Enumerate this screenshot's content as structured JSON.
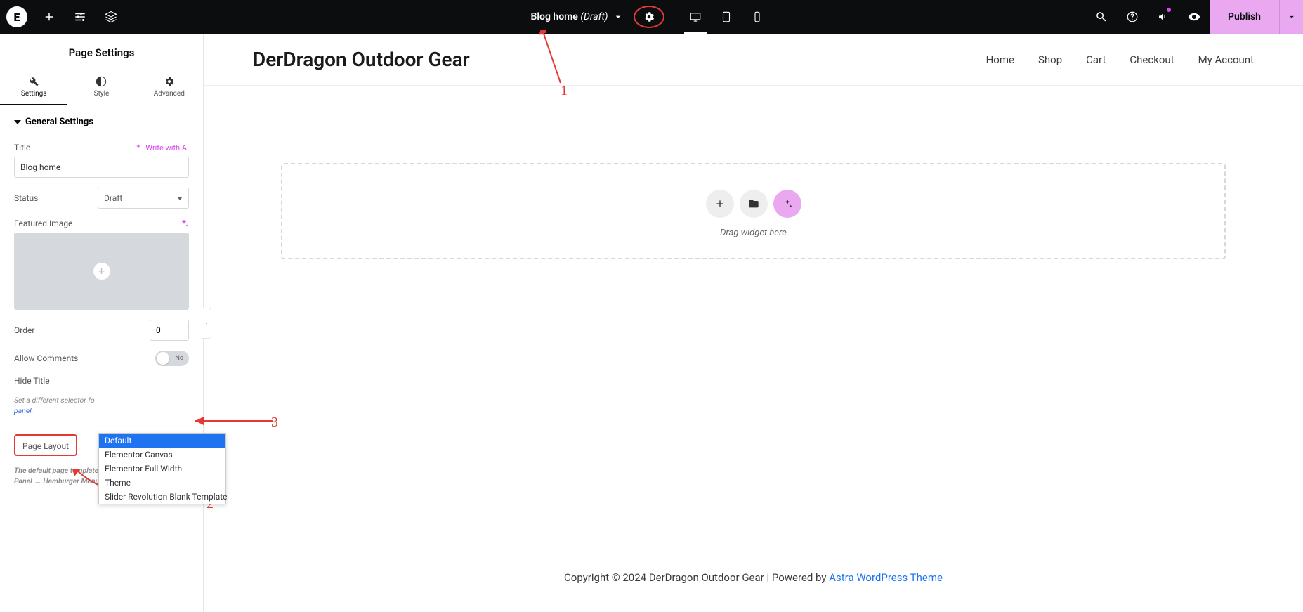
{
  "topbar": {
    "title": "Blog home",
    "status_suffix": "(Draft)",
    "publish": "Publish"
  },
  "sidebar": {
    "header": "Page Settings",
    "tabs": {
      "settings": "Settings",
      "style": "Style",
      "advanced": "Advanced"
    },
    "section": "General Settings",
    "title_label": "Title",
    "write_ai": "Write with AI",
    "title_value": "Blog home",
    "status_label": "Status",
    "status_value": "Draft",
    "featured_label": "Featured Image",
    "order_label": "Order",
    "order_value": "0",
    "comments_label": "Allow Comments",
    "comments_toggle": "No",
    "hidetitle_label": "Hide Title",
    "hidetitle_hint_pre": "Set a different selector fo",
    "hidetitle_hint_link": "panel.",
    "layout_label": "Page Layout",
    "layout_value": "Default",
    "layout_hint": "The default page template as defined in Elementor Panel → Hamburger Menu → Site Settings.",
    "layout_options": [
      "Default",
      "Elementor Canvas",
      "Elementor Full Width",
      "Theme",
      "Slider Revolution Blank Template"
    ]
  },
  "canvas": {
    "site_title": "DerDragon Outdoor Gear",
    "nav": [
      "Home",
      "Shop",
      "Cart",
      "Checkout",
      "My Account"
    ],
    "drop_text": "Drag widget here",
    "footer_pre": "Copyright © 2024 DerDragon Outdoor Gear | Powered by ",
    "footer_link": "Astra WordPress Theme"
  },
  "annotations": {
    "n1": "1",
    "n2": "2",
    "n3": "3"
  }
}
